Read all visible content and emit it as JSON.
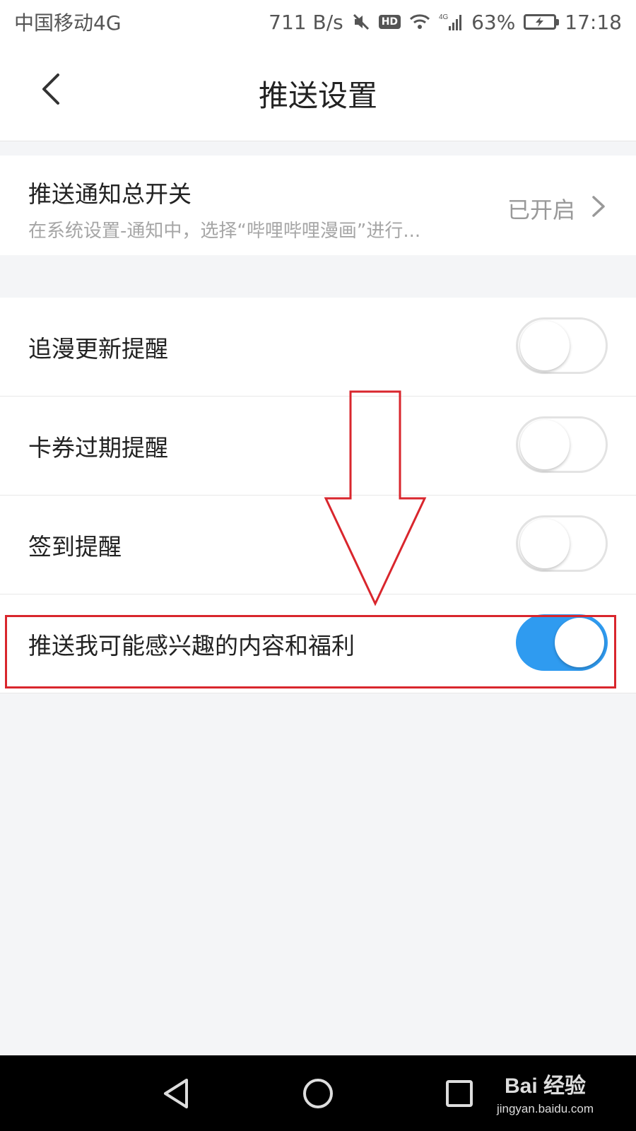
{
  "status_bar": {
    "carrier": "中国移动4G",
    "speed": "711 B/s",
    "hd_badge": "HD",
    "network": "4G",
    "battery": "63%",
    "time": "17:18"
  },
  "header": {
    "title": "推送设置",
    "back_icon": "chevron-left-icon"
  },
  "master_switch": {
    "title": "推送通知总开关",
    "subtitle": "在系统设置-通知中，选择“哔哩哔哩漫画”进行...",
    "status": "已开启"
  },
  "toggles": [
    {
      "label": "追漫更新提醒",
      "on": false
    },
    {
      "label": "卡券过期提醒",
      "on": false
    },
    {
      "label": "签到提醒",
      "on": false
    },
    {
      "label": "推送我可能感兴趣的内容和福利",
      "on": true
    }
  ],
  "watermark": {
    "brand": "Bai 经验",
    "url": "jingyan.baidu.com"
  },
  "colors": {
    "accent": "#2f9bf0",
    "annotation": "#d9262d",
    "background": "#f4f5f7"
  }
}
